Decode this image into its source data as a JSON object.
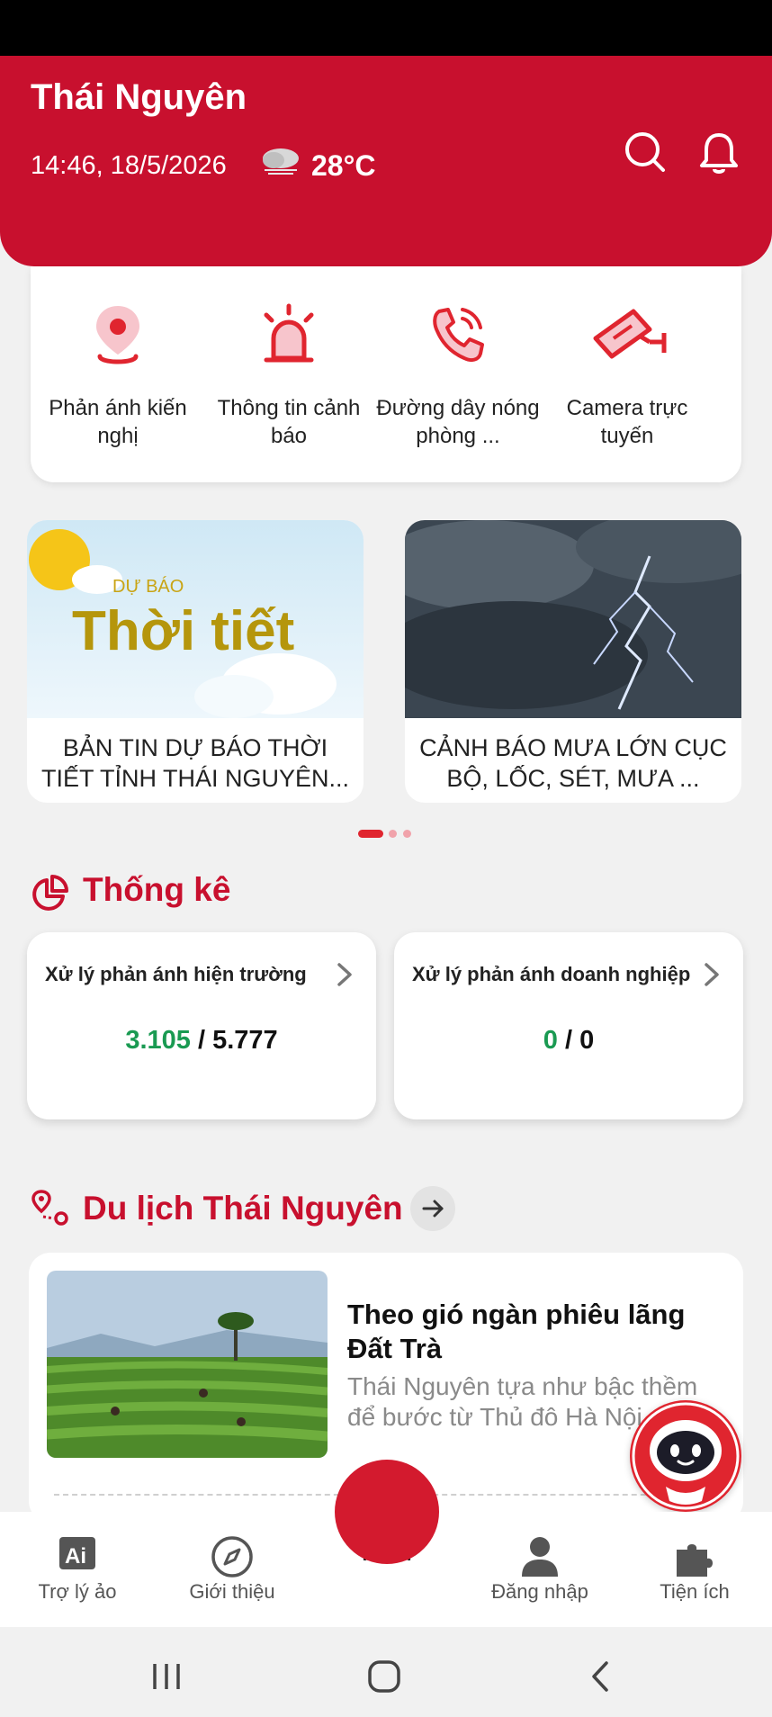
{
  "header": {
    "city": "Thái Nguyên",
    "datetime": "14:46, 18/5/2026",
    "temperature": "28°C",
    "weather_icon": "cloud-storm-icon",
    "bg_color": "#c8102e"
  },
  "quick_actions": [
    {
      "label": "Phản ánh kiến nghị",
      "icon": "location-pin-icon"
    },
    {
      "label": "Thông tin cảnh báo",
      "icon": "siren-icon"
    },
    {
      "label": "Đường dây nóng phòng ...",
      "icon": "phone-call-icon"
    },
    {
      "label": "Camera trực tuyến",
      "icon": "cctv-camera-icon"
    }
  ],
  "news": [
    {
      "image_text_small": "DỰ BÁO",
      "image_text_large": "Thời tiết",
      "title": "BẢN TIN DỰ BÁO THỜI TIẾT TỈNH THÁI NGUYÊN..."
    },
    {
      "title": "CẢNH BÁO MƯA LỚN CỤC BỘ, LỐC, SÉT, MƯA ..."
    }
  ],
  "carousel": {
    "count": 3,
    "active": 1
  },
  "statistics": {
    "title": "Thống kê",
    "cards": [
      {
        "title": "Xử lý phản ánh hiện trường",
        "done": "3.105",
        "sep": " / ",
        "total": "5.777"
      },
      {
        "title": "Xử lý phản ánh doanh nghiệp",
        "done": "0",
        "sep": " / ",
        "total": "0"
      }
    ]
  },
  "tourism": {
    "title": "Du lịch Thái Nguyên",
    "article_title": "Theo gió ngàn phiêu lãng Đất Trà",
    "article_desc": "Thái Nguyên tựa như bậc thềm để bước từ Thủ đô Hà Nội"
  },
  "bottom_nav": {
    "items": [
      {
        "label": "Trợ lý ảo",
        "icon": "ai-assistant-icon"
      },
      {
        "label": "Giới thiệu",
        "icon": "compass-icon"
      },
      {
        "label": "Đăng nhập",
        "icon": "user-icon"
      },
      {
        "label": "Tiện ích",
        "icon": "puzzle-icon"
      }
    ],
    "center_label": "Khẩn"
  },
  "colors": {
    "primary": "#c8102e",
    "success": "#1a9a52",
    "background": "#f1f1f1"
  }
}
